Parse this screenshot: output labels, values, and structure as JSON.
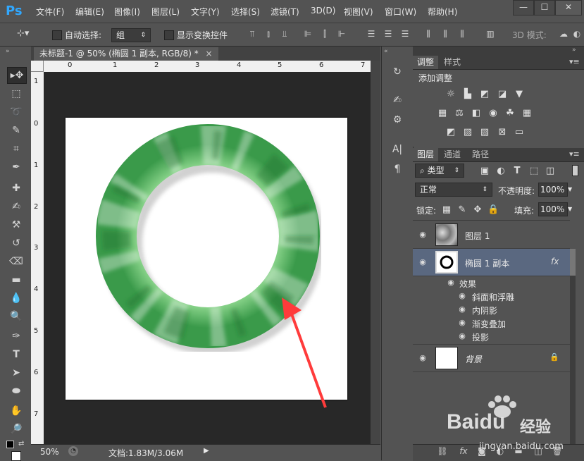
{
  "app": {
    "logo": "Ps"
  },
  "menu": [
    "文件(F)",
    "编辑(E)",
    "图像(I)",
    "图层(L)",
    "文字(Y)",
    "选择(S)",
    "滤镜(T)",
    "3D(D)",
    "视图(V)",
    "窗口(W)",
    "帮助(H)"
  ],
  "window_controls": {
    "minimize": "—",
    "maximize": "☐",
    "close": "✕"
  },
  "options": {
    "auto_select_label": "自动选择:",
    "auto_select_value": "组",
    "show_transform_label": "显示变换控件",
    "mode_3d_label": "3D 模式:"
  },
  "document": {
    "tab_title": "未标题-1 @ 50% (椭圆 1 副本, RGB/8) *",
    "tab_close": "×",
    "ruler_h": [
      "0",
      "1",
      "2",
      "3",
      "4",
      "5",
      "6",
      "7"
    ],
    "ruler_v": [
      "1",
      "0",
      "1",
      "2",
      "3",
      "4",
      "5",
      "6",
      "7"
    ],
    "zoom": "50%",
    "doc_size": "文档:1.83M/3.06M"
  },
  "adjustments": {
    "tabs": [
      "调整",
      "样式"
    ],
    "heading": "添加调整"
  },
  "layers_panel": {
    "tabs": [
      "图层",
      "通道",
      "路径"
    ],
    "filter_kind": "类型",
    "blend_mode": "正常",
    "opacity_label": "不透明度:",
    "opacity_value": "100%",
    "lock_label": "锁定:",
    "fill_label": "填充:",
    "fill_value": "100%",
    "layers": [
      {
        "name": "图层 1"
      },
      {
        "name": "椭圆 1 副本",
        "fx": "fx"
      },
      {
        "name": "背景"
      }
    ],
    "effects_heading": "效果",
    "effects": [
      "斜面和浮雕",
      "内阴影",
      "渐变叠加",
      "投影"
    ]
  },
  "watermark": {
    "brand": "Baidu",
    "sub": "经验",
    "url": "jingyan.baidu.com"
  },
  "colors": {
    "annotation_arrow": "#ff3b3b",
    "ring_green": "#5cc46a",
    "selected_layer": "#5a6880"
  }
}
